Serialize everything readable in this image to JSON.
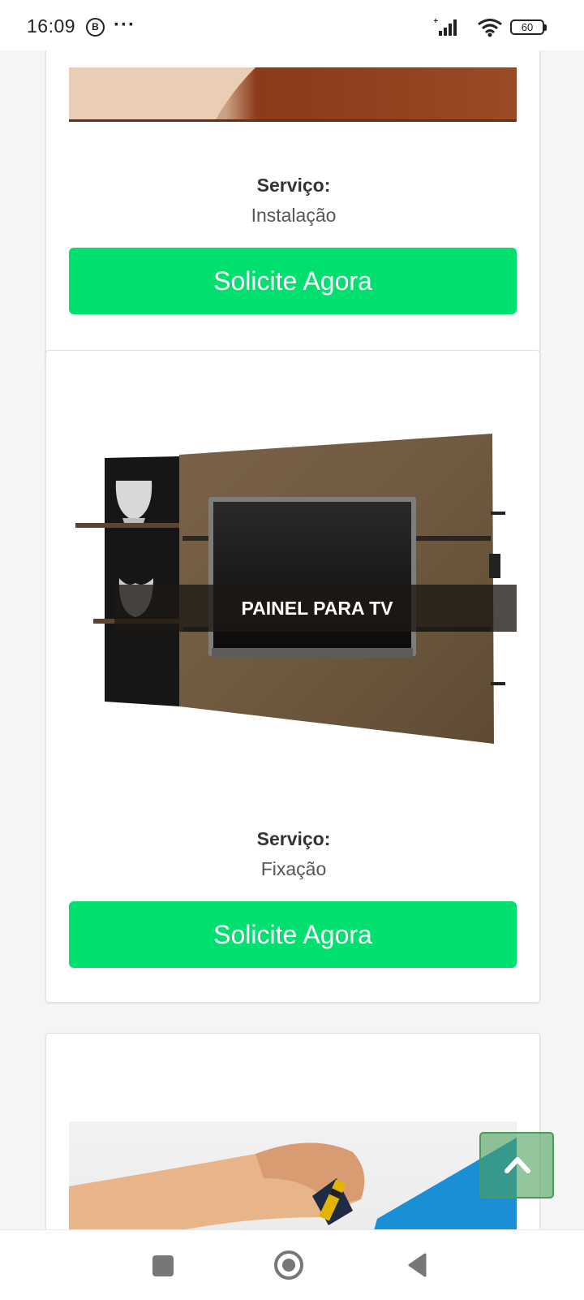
{
  "status_bar": {
    "time": "16:09",
    "notification_badge": "B",
    "more": "···",
    "network": "H+",
    "battery": "60"
  },
  "cards": [
    {
      "image_name": "installation-photo",
      "service_label": "Serviço:",
      "service_value": "Instalação",
      "button_label": "Solicite Agora"
    },
    {
      "image_name": "tv-panel-photo",
      "image_caption": "PAINEL PARA TV",
      "service_label": "Serviço:",
      "service_value": "Fixação",
      "button_label": "Solicite Agora"
    },
    {
      "image_name": "hands-tools-photo"
    }
  ],
  "back_to_top_icon": "chevron-up-icon",
  "nav_bar": {
    "recent_icon": "square-recent-apps-icon",
    "home_icon": "circle-home-icon",
    "back_icon": "triangle-back-icon"
  },
  "colors": {
    "cta_green": "#00e06f",
    "page_background": "#f5f5f5",
    "back_to_top": "#4ba05a"
  }
}
